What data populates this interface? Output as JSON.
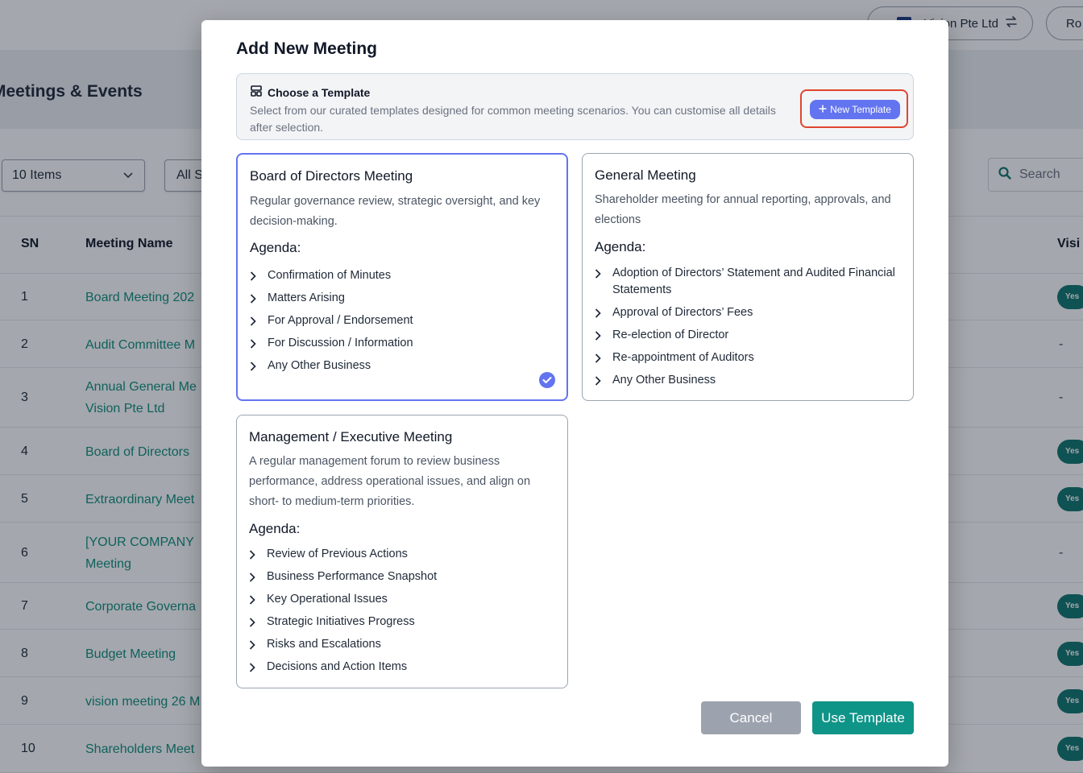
{
  "topbar": {
    "company_label": "Vision Pte Ltd",
    "role_label": "Ro"
  },
  "page": {
    "title": "Meetings & Events",
    "items_select": "10 Items",
    "filter_select": "All S",
    "search_placeholder": "Search"
  },
  "table": {
    "headers": {
      "sn": "SN",
      "name": "Meeting Name",
      "visible": "Visi"
    },
    "rows": [
      {
        "sn": "1",
        "name": "Board Meeting 202",
        "visible": "Yes"
      },
      {
        "sn": "2",
        "name": "Audit Committee M",
        "visible": "-"
      },
      {
        "sn": "3",
        "name": "Annual General Me Vision Pte Ltd",
        "visible": "-"
      },
      {
        "sn": "4",
        "name": "Board of Directors",
        "visible": "Yes"
      },
      {
        "sn": "5",
        "name": "Extraordinary Meet",
        "visible": "Yes"
      },
      {
        "sn": "6",
        "name": "[YOUR COMPANY Meeting",
        "visible": "-"
      },
      {
        "sn": "7",
        "name": "Corporate Governa",
        "visible": "Yes"
      },
      {
        "sn": "8",
        "name": "Budget Meeting",
        "visible": "Yes"
      },
      {
        "sn": "9",
        "name": "vision meeting 26 M",
        "visible": "Yes"
      },
      {
        "sn": "10",
        "name": "Shareholders Meet",
        "visible": "Yes"
      }
    ]
  },
  "modal": {
    "title": "Add New Meeting",
    "banner": {
      "heading": "Choose a Template",
      "description": "Select from our curated templates designed for common meeting scenarios. You can customise all details after selection.",
      "new_template_label": "New Template"
    },
    "agenda_label": "Agenda:",
    "templates": [
      {
        "title": "Board of Directors Meeting",
        "description": "Regular governance review, strategic oversight, and key decision-making.",
        "selected": true,
        "agenda": [
          "Confirmation of Minutes",
          "Matters Arising",
          "For Approval / Endorsement",
          "For Discussion / Information",
          "Any Other Business"
        ]
      },
      {
        "title": "General Meeting",
        "description": "Shareholder meeting for annual reporting, approvals, and elections",
        "selected": false,
        "agenda": [
          "Adoption of Directors’ Statement and Audited Financial Statements",
          "Approval of Directors’ Fees",
          "Re-election of Director",
          "Re-appointment of Auditors",
          "Any Other Business"
        ]
      },
      {
        "title": "Management / Executive Meeting",
        "description": "A regular management forum to review business performance, address operational issues, and align on short- to medium-term priorities.",
        "selected": false,
        "agenda": [
          "Review of Previous Actions",
          "Business Performance Snapshot",
          "Key Operational Issues",
          "Strategic Initiatives Progress",
          "Risks and Escalations",
          "Decisions and Action Items"
        ]
      }
    ],
    "cancel_label": "Cancel",
    "use_template_label": "Use Template"
  },
  "colors": {
    "accent": "#6374f0",
    "primary": "#0f9488",
    "link": "#0f8f7e",
    "highlight_border": "#e0452f"
  }
}
